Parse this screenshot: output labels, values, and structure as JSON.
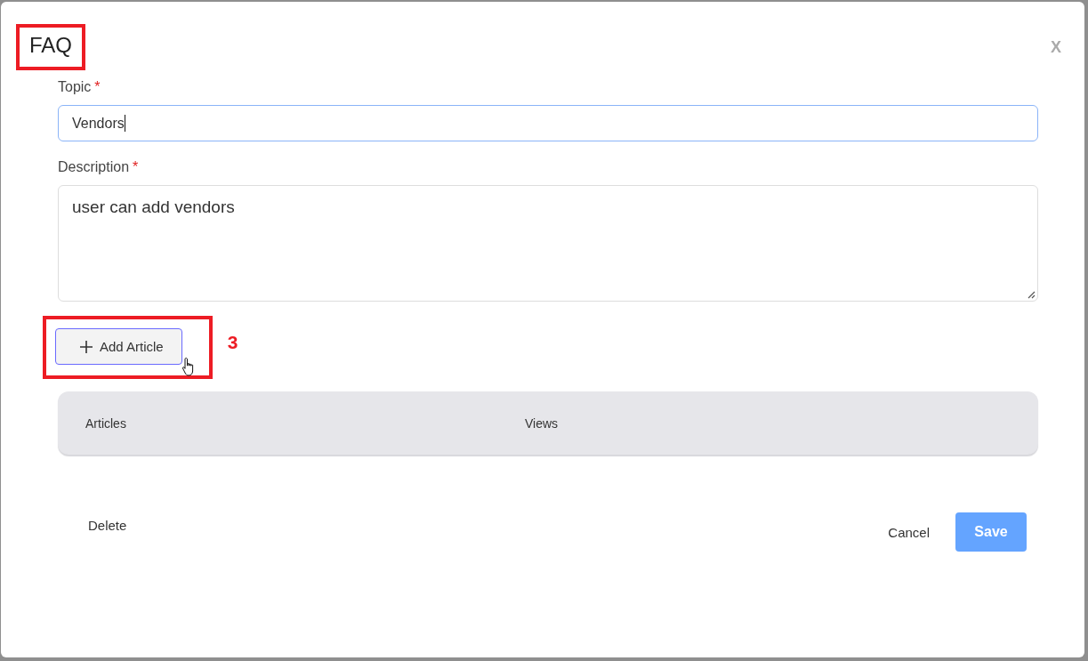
{
  "dialog": {
    "title": "FAQ",
    "close": "X"
  },
  "fields": [
    {
      "kind": "input",
      "label": "Topic",
      "required_mark": "*",
      "value": "Vendors",
      "focused": true
    },
    {
      "kind": "textarea",
      "label": "Description",
      "required_mark": "*",
      "value": "user can add vendors",
      "focused": false
    }
  ],
  "add_button": {
    "label": "Add Article"
  },
  "table": {
    "columns": [
      "Articles",
      "Views"
    ]
  },
  "footer": {
    "delete": "Delete",
    "cancel": "Cancel",
    "save": "Save"
  },
  "annotations": {
    "title_box": true,
    "button_box": true,
    "button_number": "3"
  }
}
